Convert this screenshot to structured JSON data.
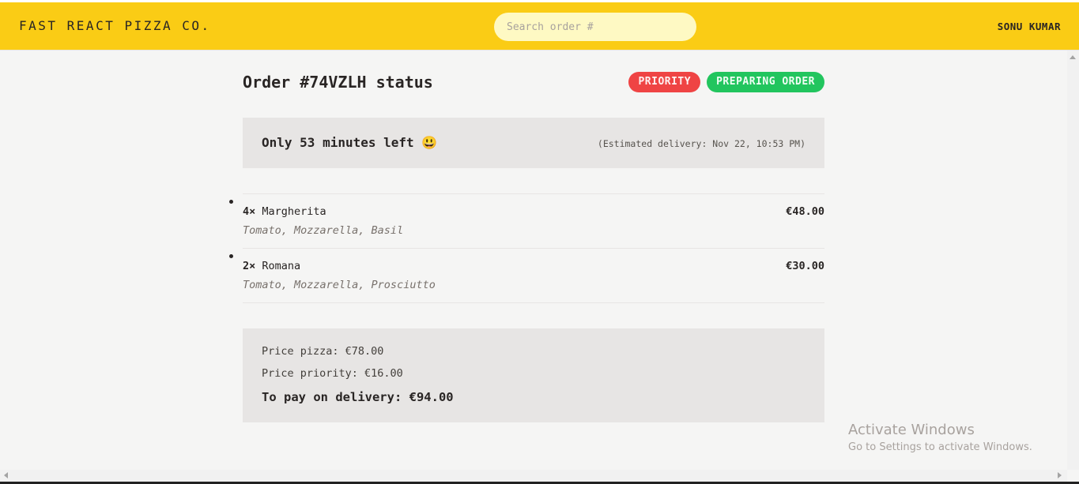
{
  "header": {
    "logo": "FAST REACT PIZZA CO.",
    "search_placeholder": "Search order #",
    "username": "SONU KUMAR"
  },
  "order": {
    "title": "Order #74VZLH status",
    "badges": {
      "priority": "PRIORITY",
      "status": "PREPARING ORDER"
    },
    "eta": {
      "remaining": "Only 53 minutes left 😃",
      "estimated": "(Estimated delivery: Nov 22, 10:53 PM)"
    },
    "items": [
      {
        "qty": "4×",
        "name": "Margherita",
        "price": "€48.00",
        "ingredients": "Tomato, Mozzarella, Basil"
      },
      {
        "qty": "2×",
        "name": "Romana",
        "price": "€30.00",
        "ingredients": "Tomato, Mozzarella, Prosciutto"
      }
    ],
    "summary": {
      "price_pizza": "Price pizza: €78.00",
      "price_priority": "Price priority: €16.00",
      "total": "To pay on delivery: €94.00"
    }
  },
  "watermark": {
    "title": "Activate Windows",
    "subtitle": "Go to Settings to activate Windows."
  },
  "colors": {
    "header_bg": "#facc15",
    "priority_badge": "#ef4444",
    "status_badge": "#22c55e",
    "panel_bg": "#e7e5e4",
    "page_bg": "#f5f5f4"
  }
}
